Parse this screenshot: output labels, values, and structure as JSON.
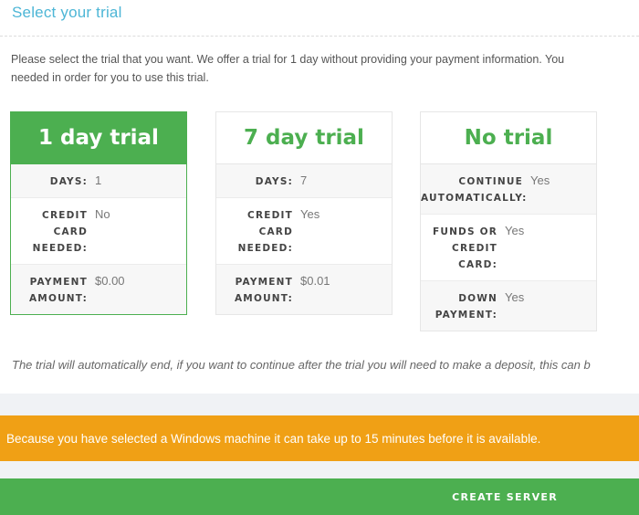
{
  "page": {
    "title": "Select your trial",
    "intro_line1": "Please select the trial that you want. We offer a trial for 1 day without providing your payment information. You",
    "intro_line2": "needed in order for you to use this trial.",
    "footnote": "The trial will automatically end, if you want to continue after the trial you will need to make a deposit, this can b"
  },
  "trials": [
    {
      "title": "1 day trial",
      "selected": true,
      "rows": [
        {
          "label": "DAYS:",
          "value": "1"
        },
        {
          "label": "CREDIT CARD NEEDED:",
          "value": "No"
        },
        {
          "label": "PAYMENT AMOUNT:",
          "value": "$0.00"
        }
      ]
    },
    {
      "title": "7 day trial",
      "selected": false,
      "rows": [
        {
          "label": "DAYS:",
          "value": "7"
        },
        {
          "label": "CREDIT CARD NEEDED:",
          "value": "Yes"
        },
        {
          "label": "PAYMENT AMOUNT:",
          "value": "$0.01"
        }
      ]
    },
    {
      "title": "No trial",
      "selected": false,
      "rows": [
        {
          "label": "CONTINUE AUTOMATICALLY:",
          "value": "Yes"
        },
        {
          "label": "FUNDS OR CREDIT CARD:",
          "value": "Yes"
        },
        {
          "label": "DOWN PAYMENT:",
          "value": "Yes"
        }
      ]
    }
  ],
  "notice": {
    "text": "Because you have selected a Windows machine it can take up to 15 minutes before it is available.",
    "color": "#f0a015"
  },
  "actions": {
    "create_label": "CREATE SERVER",
    "accent": "#4caf50"
  }
}
